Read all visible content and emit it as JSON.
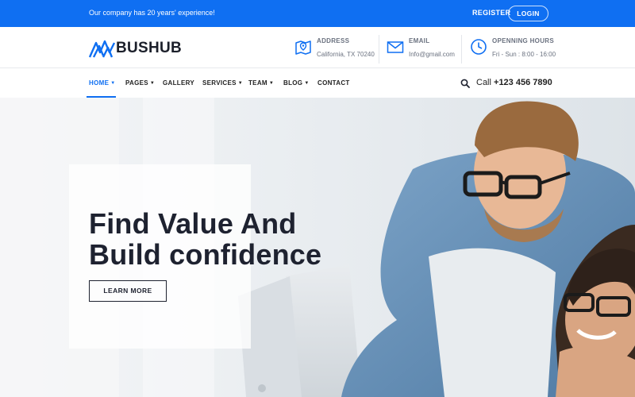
{
  "topbar": {
    "message": "Our company has 20 years' experience!",
    "register_label": "REGISTER",
    "login_label": "LOGIN"
  },
  "header": {
    "logo_text": "BUSHUB",
    "address": {
      "title": "ADDRESS",
      "value": "California, TX 70240",
      "icon": "map-icon"
    },
    "email": {
      "title": "EMAIL",
      "value": "Info@gmail.com",
      "icon": "envelope-icon"
    },
    "hours": {
      "title": "OPENNING HOURS",
      "value": "Fri - Sun : 8:00 - 16:00",
      "icon": "clock-icon"
    }
  },
  "nav": {
    "items": [
      {
        "label": "HOME",
        "has_dropdown": true,
        "active": true
      },
      {
        "label": "PAGES",
        "has_dropdown": true
      },
      {
        "label": "GALLERY",
        "has_dropdown": false
      },
      {
        "label": "SERVICES",
        "has_dropdown": true
      },
      {
        "label": "TEAM",
        "has_dropdown": true
      },
      {
        "label": "BLOG",
        "has_dropdown": true
      },
      {
        "label": "CONTACT",
        "has_dropdown": false
      }
    ],
    "call_prefix": "Call",
    "phone": "+123 456 7890"
  },
  "hero": {
    "title_line1": "Find Value And",
    "title_line2": "Build confidence",
    "button_label": "LEARN MORE"
  },
  "colors": {
    "accent": "#0f6ff2",
    "dark_text": "#1e2230"
  }
}
